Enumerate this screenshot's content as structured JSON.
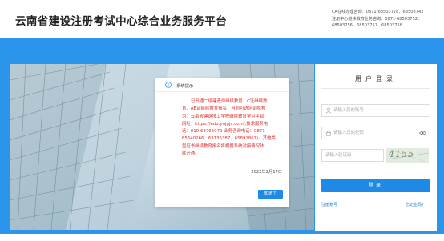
{
  "header": {
    "site_title": "云南省建设注册考试中心综合业务服务平台",
    "contact_lines": [
      "CA在线办理咨询：0871-68503778、68503742",
      "注册中心继续教育业务咨询：0871-68503752、",
      "68503756、68503757、68503758"
    ]
  },
  "login": {
    "title": "用户登录",
    "username_placeholder": "请输入您的账号",
    "password_placeholder": "请输入您的密码",
    "captcha_placeholder": "请输入验证码",
    "captcha_code": "4155",
    "login_button": "登录",
    "register_link": "注册账号",
    "forgot_link": "忘记密码?"
  },
  "modal": {
    "title": "系统提示",
    "notice_lines": [
      "已开通二级建造师继续教育、C证继续教",
      "育、AB证继续教育报名，当前可选培训机构",
      "为：云南省建筑技工学校继续教育学习平台",
      "网址：https://edu.ynjgjx.com/,技术服务电",
      "话：010-63765979 业务咨询电话：0871-",
      "65640266、63136387、65891867)。其他类",
      "型证书继续教育报名将根据系统对接情况陆",
      "续开通。"
    ],
    "date": "2022年2月17日",
    "ok_button": "知道了"
  },
  "colors": {
    "band": "#2a95ea",
    "accent": "#1e8ae5",
    "notice_text": "#e02c2c"
  },
  "icons": {
    "info": "info-icon",
    "user": "user-icon",
    "lock": "lock-icon",
    "eye": "eye-icon"
  }
}
